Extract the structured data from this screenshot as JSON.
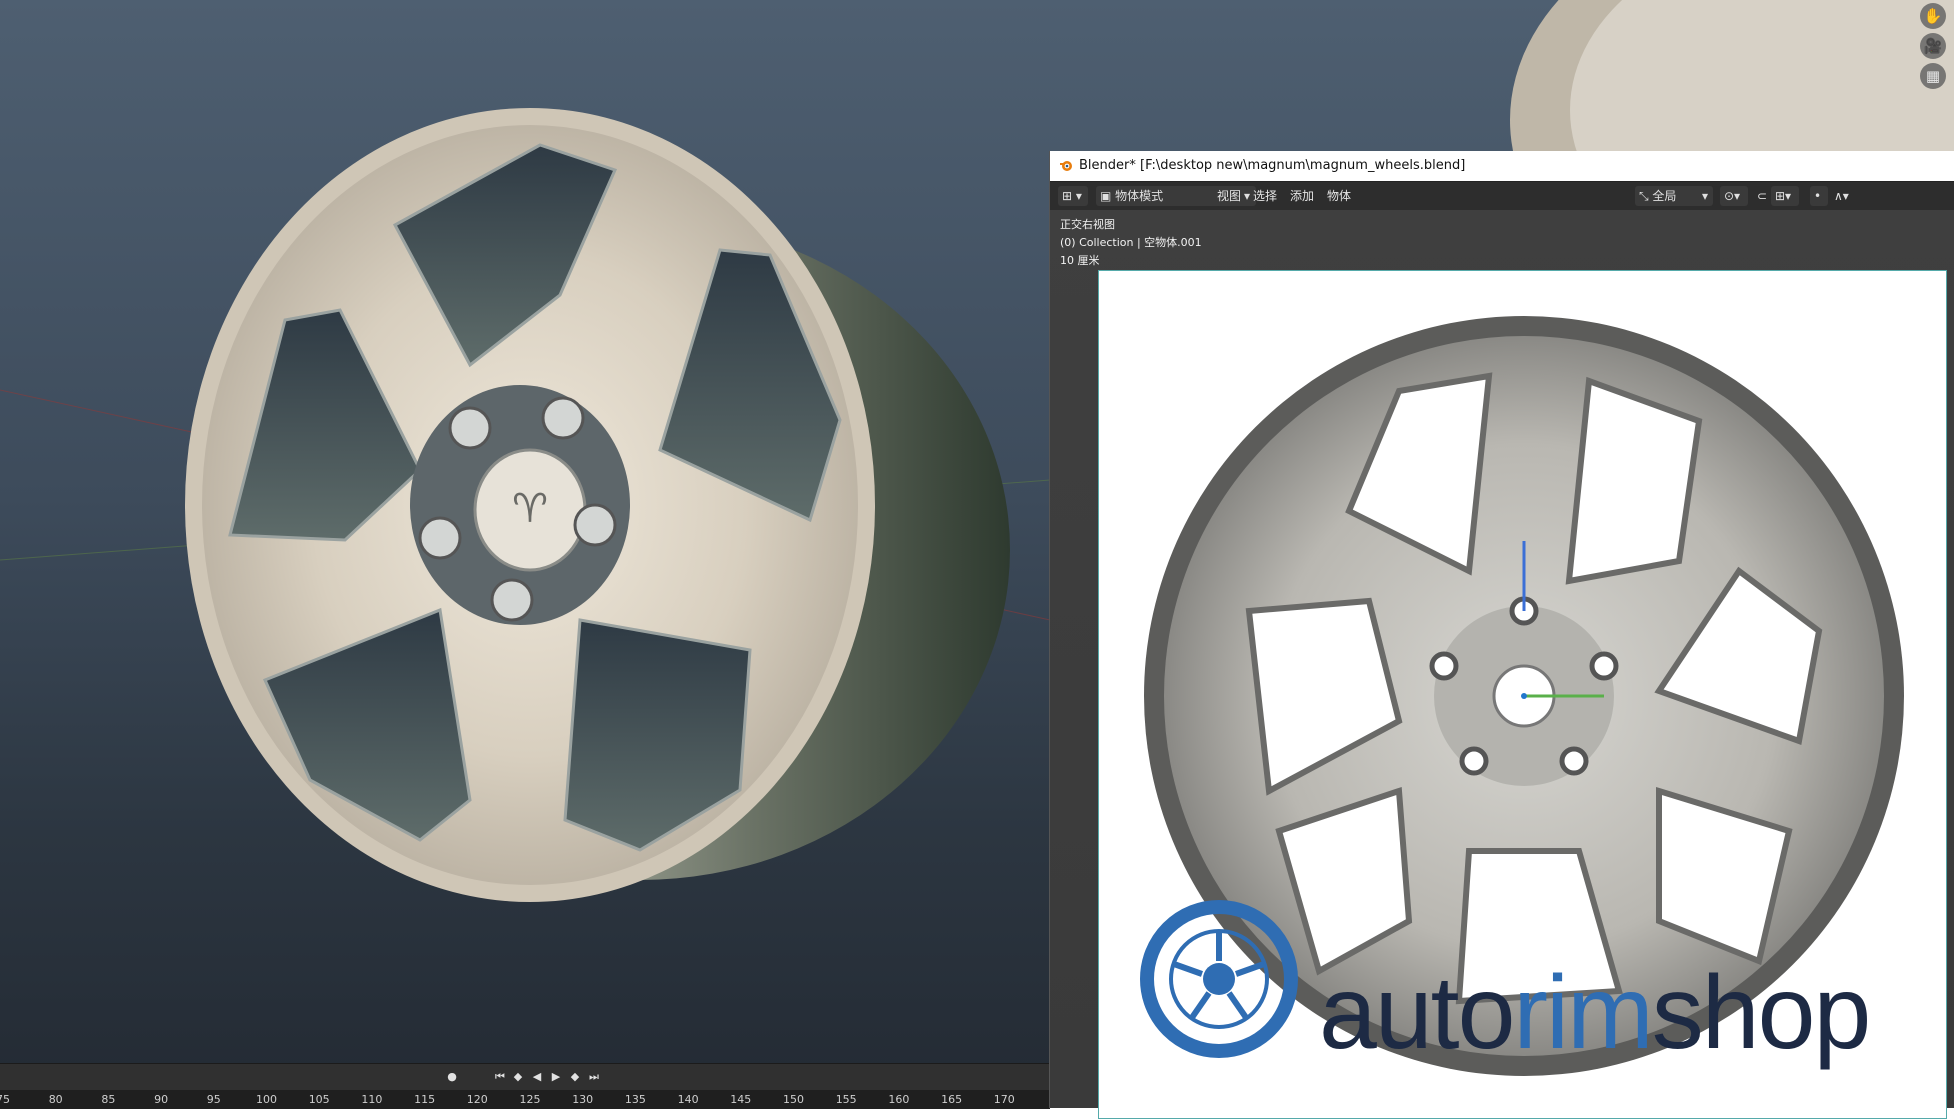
{
  "gizmo": {
    "pan_icon": "✋",
    "camera_icon": "🎥",
    "grid_icon": "▦"
  },
  "timeline": {
    "ticks": [
      "75",
      "80",
      "85",
      "90",
      "95",
      "100",
      "105",
      "110",
      "115",
      "120",
      "125",
      "130",
      "135",
      "140",
      "145",
      "150",
      "155",
      "160",
      "165",
      "170"
    ]
  },
  "window": {
    "title": "Blender* [F:\\desktop new\\magnum\\magnum_wheels.blend]"
  },
  "header": {
    "mode": "物体模式",
    "menu": [
      "视图",
      "选择",
      "添加",
      "物体"
    ],
    "transform_orientation": "全局"
  },
  "overlay": {
    "view_name": "正交右视图",
    "collection": "(0) Collection | 空物体.001",
    "scale": "10 厘米"
  },
  "reference_image": {
    "brand_a": "auto",
    "brand_b": "rim",
    "brand_c": "shop",
    "brand_dark_color": "#1d2a44",
    "brand_blue_color": "#2f6db3"
  },
  "colors": {
    "viewport_top": "#4e5f71",
    "viewport_bottom": "#232a33",
    "rim_metal": "#d9d1c4"
  }
}
